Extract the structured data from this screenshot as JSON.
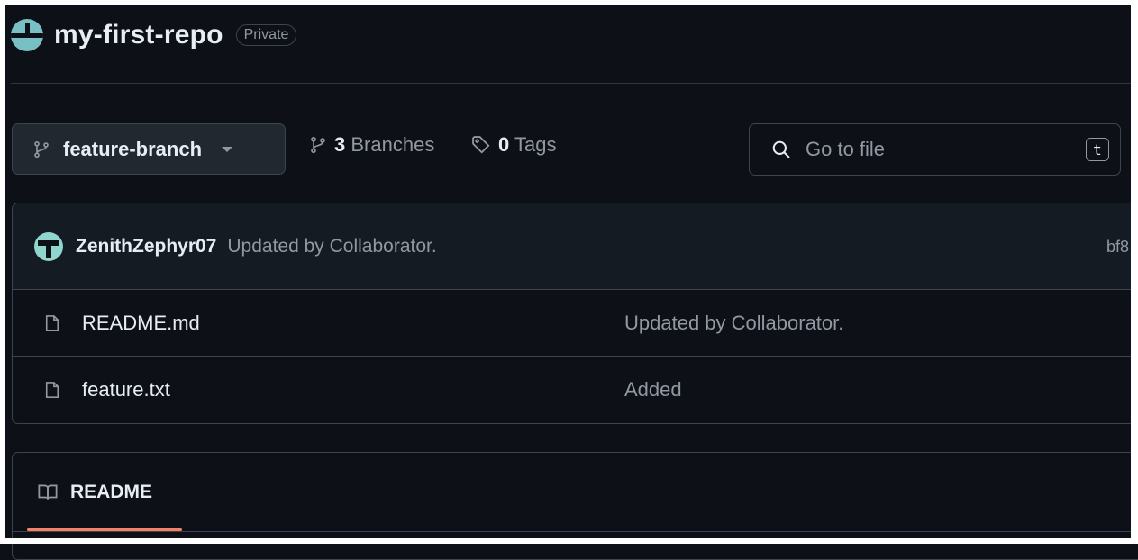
{
  "repo": {
    "name": "my-first-repo",
    "visibility": "Private"
  },
  "toolbar": {
    "current_branch": "feature-branch",
    "branches_count": "3",
    "branches_label": "Branches",
    "tags_count": "0",
    "tags_label": "Tags",
    "search_placeholder": "Go to file",
    "search_shortcut": "t"
  },
  "latest_commit": {
    "author": "ZenithZephyr07",
    "message": "Updated by Collaborator.",
    "hash_partial": "bf8"
  },
  "files": [
    {
      "name": "README.md",
      "last_commit": "Updated by Collaborator."
    },
    {
      "name": "feature.txt",
      "last_commit": "Added"
    }
  ],
  "readme": {
    "tab_label": "README"
  },
  "colors": {
    "background": "#0d1117",
    "border": "#3d444d",
    "muted_text": "#9198a1",
    "active_tab_underline": "#f78166"
  }
}
